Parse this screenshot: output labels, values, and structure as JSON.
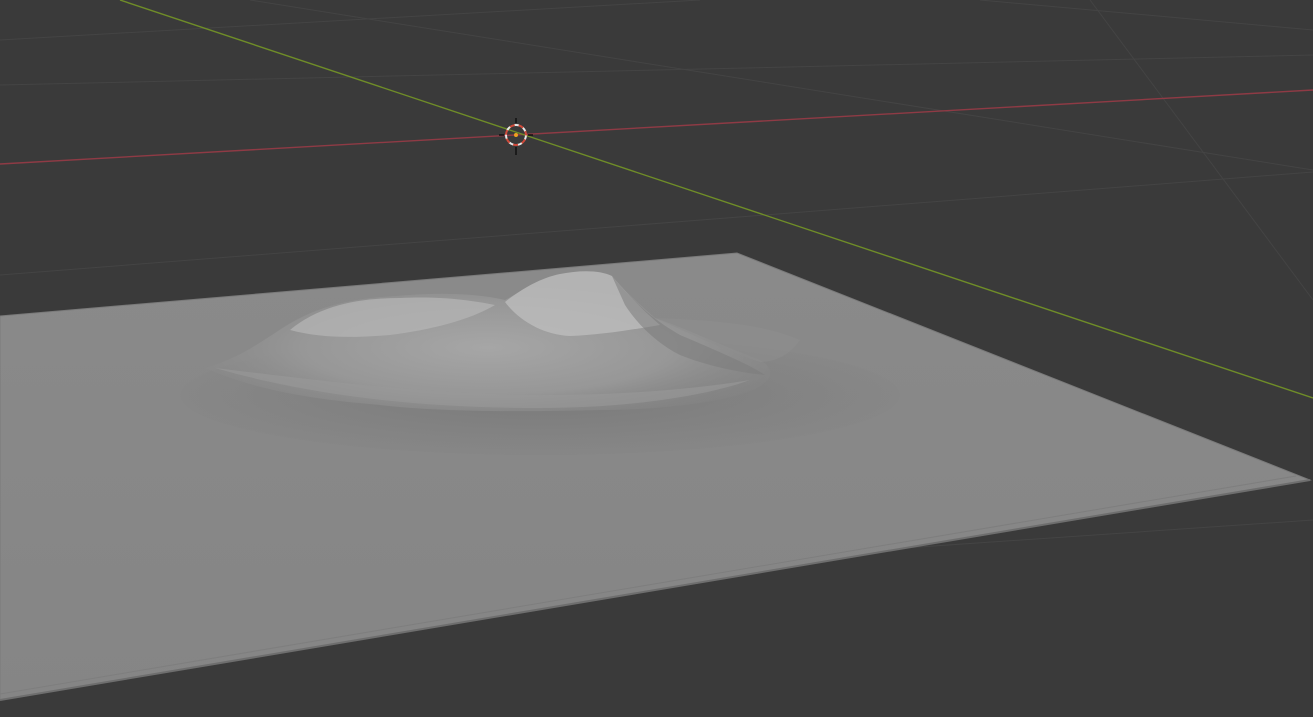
{
  "viewport": {
    "kind": "3d-viewport",
    "background_color": "#3a3a3a",
    "grid_line_color": "#444444",
    "x_axis_color": "#8f3a45",
    "y_axis_color": "#6f8d28",
    "plane_color": "#888888",
    "plane_edge_color": "#707070"
  },
  "objects": {
    "terrain": {
      "icon": "terrain-mesh"
    },
    "cursor": {
      "icon": "3d-cursor-icon",
      "ring_color": "#e8e8e8",
      "accent_color": "#d04a3a",
      "center_color": "#f0a020"
    }
  }
}
